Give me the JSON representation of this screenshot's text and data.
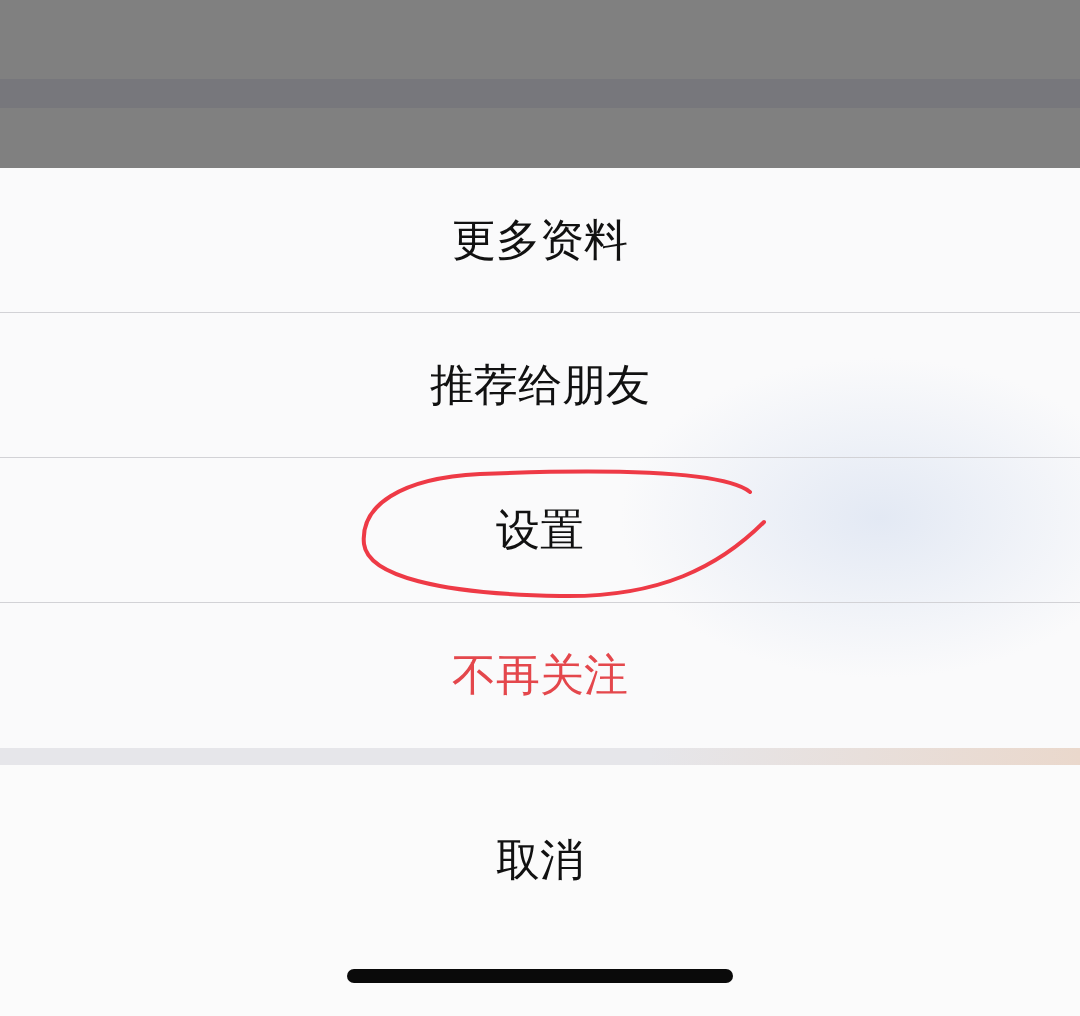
{
  "action_sheet": {
    "items": [
      {
        "label": "更多资料",
        "kind": "normal",
        "circled": false
      },
      {
        "label": "推荐给朋友",
        "kind": "normal",
        "circled": false
      },
      {
        "label": "设置",
        "kind": "normal",
        "circled": true
      },
      {
        "label": "不再关注",
        "kind": "destructive",
        "circled": false
      }
    ],
    "cancel": {
      "label": "取消"
    }
  }
}
